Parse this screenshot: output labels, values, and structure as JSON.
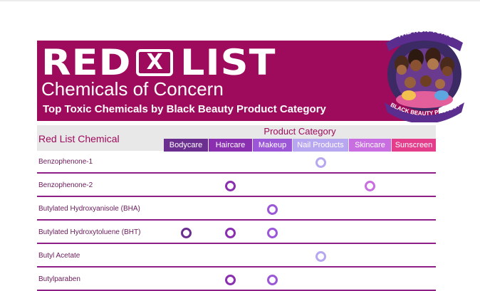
{
  "header": {
    "title_left": "RED",
    "title_box": "X",
    "title_right": "LIST",
    "subtitle": "Chemicals of Concern",
    "tagline": "Top Toxic Chemicals by Black Beauty Product Category"
  },
  "logo": {
    "top_text": "THE NON-TOXIC",
    "bottom_text": "BLACK BEAUTY PROJECT"
  },
  "table": {
    "first_column_header": "Red List Chemical",
    "group_header": "Product Category",
    "categories": [
      {
        "label": "Bodycare",
        "color": "#6b2f8f"
      },
      {
        "label": "Haircare",
        "color": "#8a2fb0"
      },
      {
        "label": "Makeup",
        "color": "#9b57d8"
      },
      {
        "label": "Nail Products",
        "color": "#b7a6f0"
      },
      {
        "label": "Skincare",
        "color": "#c96ee0"
      },
      {
        "label": "Sunscreen",
        "color": "#e33d8b"
      }
    ],
    "rows": [
      {
        "chemical": "Benzophenone-1",
        "marks": [
          false,
          false,
          false,
          true,
          false,
          false
        ]
      },
      {
        "chemical": "Benzophenone-2",
        "marks": [
          false,
          true,
          false,
          false,
          true,
          false
        ]
      },
      {
        "chemical": "Butylated Hydroxyanisole (BHA)",
        "marks": [
          false,
          false,
          true,
          false,
          false,
          false
        ]
      },
      {
        "chemical": "Butylated Hydroxytoluene (BHT)",
        "marks": [
          true,
          true,
          true,
          false,
          false,
          false
        ]
      },
      {
        "chemical": "Butyl Acetate",
        "marks": [
          false,
          false,
          false,
          true,
          false,
          false
        ]
      },
      {
        "chemical": "Butylparaben",
        "marks": [
          false,
          true,
          true,
          false,
          false,
          false
        ]
      }
    ]
  },
  "colors": {
    "banner": "#9e0b5c",
    "row_divider": "#8e1f86",
    "header_band": "#e8e8e8"
  }
}
